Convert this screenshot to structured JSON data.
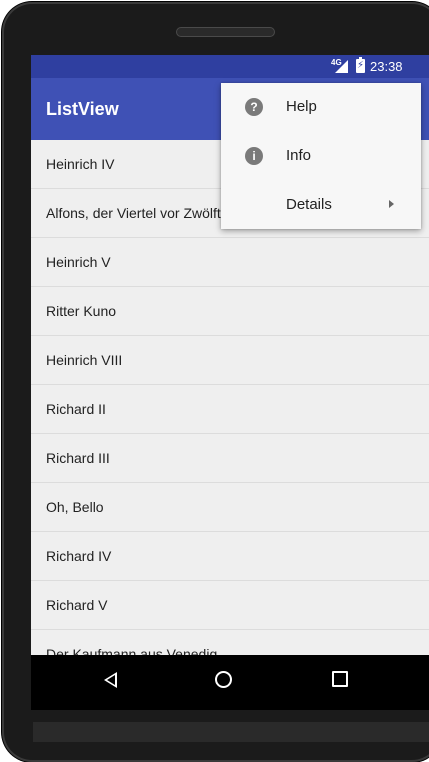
{
  "status_bar": {
    "network": "4G",
    "time": "23:38"
  },
  "app_bar": {
    "title": "ListView"
  },
  "list": {
    "items": [
      "Heinrich IV",
      "Alfons, der Viertel vor Zwölfte",
      "Heinrich V",
      "Ritter Kuno",
      "Heinrich VIII",
      "Richard II",
      "Richard III",
      "Oh, Bello",
      "Richard IV",
      "Richard V",
      "Der Kaufmann aus Venedig"
    ]
  },
  "menu": {
    "items": [
      {
        "label": "Help",
        "icon": "help-icon",
        "glyph": "?"
      },
      {
        "label": "Info",
        "icon": "info-icon",
        "glyph": "i"
      },
      {
        "label": "Details",
        "icon": "",
        "has_submenu": true
      }
    ]
  },
  "nav_bar": {
    "back": "back-icon",
    "home": "home-icon",
    "recent": "recent-apps-icon"
  }
}
